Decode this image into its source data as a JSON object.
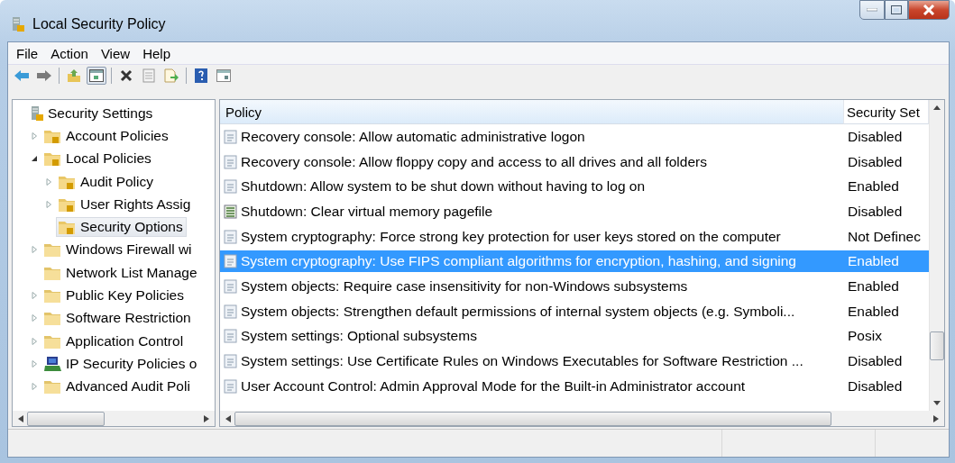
{
  "window": {
    "title": "Local Security Policy"
  },
  "menu": [
    "File",
    "Action",
    "View",
    "Help"
  ],
  "toolbar": [
    {
      "kind": "back",
      "pressed": false
    },
    {
      "kind": "forward",
      "pressed": false
    },
    {
      "kind": "sep"
    },
    {
      "kind": "up",
      "pressed": false
    },
    {
      "kind": "tree",
      "pressed": true
    },
    {
      "kind": "sep"
    },
    {
      "kind": "delete",
      "pressed": false
    },
    {
      "kind": "properties",
      "pressed": false
    },
    {
      "kind": "export",
      "pressed": false
    },
    {
      "kind": "sep"
    },
    {
      "kind": "help",
      "pressed": false
    },
    {
      "kind": "console",
      "pressed": false
    }
  ],
  "tree": [
    {
      "label": "Security Settings",
      "kind": "root",
      "selected": false,
      "children": [
        {
          "label": "Account Policies",
          "kind": "secure",
          "expanded": false,
          "selected": false
        },
        {
          "label": "Local Policies",
          "kind": "secure",
          "expanded": true,
          "selected": false,
          "children": [
            {
              "label": "Audit Policy",
              "kind": "secure",
              "expanded": false,
              "selected": false
            },
            {
              "label": "User Rights Assig",
              "kind": "secure",
              "expanded": false,
              "selected": false
            },
            {
              "label": "Security Options",
              "kind": "secure",
              "selected": true
            }
          ]
        },
        {
          "label": "Windows Firewall wi",
          "kind": "folder",
          "expanded": false,
          "selected": false
        },
        {
          "label": "Network List Manage",
          "kind": "folder",
          "selected": false
        },
        {
          "label": "Public Key Policies",
          "kind": "folder",
          "expanded": false,
          "selected": false
        },
        {
          "label": "Software Restriction",
          "kind": "folder",
          "expanded": false,
          "selected": false
        },
        {
          "label": "Application Control",
          "kind": "folder",
          "expanded": false,
          "selected": false
        },
        {
          "label": "IP Security Policies o",
          "kind": "network",
          "expanded": false,
          "selected": false
        },
        {
          "label": "Advanced Audit Poli",
          "kind": "folder",
          "expanded": false,
          "selected": false
        }
      ]
    }
  ],
  "table": {
    "columns": [
      "Policy",
      "Security Set"
    ],
    "rows": [
      {
        "policy": "Recovery console: Allow automatic administrative logon",
        "setting": "Disabled",
        "kind": "policy",
        "selected": false
      },
      {
        "policy": "Recovery console: Allow floppy copy and access to all drives and all folders",
        "setting": "Disabled",
        "kind": "policy",
        "selected": false
      },
      {
        "policy": "Shutdown: Allow system to be shut down without having to log on",
        "setting": "Enabled",
        "kind": "policy",
        "selected": false
      },
      {
        "policy": "Shutdown: Clear virtual memory pagefile",
        "setting": "Disabled",
        "kind": "pagefile",
        "selected": false
      },
      {
        "policy": "System cryptography: Force strong key protection for user keys stored on the computer",
        "setting": "Not Definec",
        "kind": "policy",
        "selected": false
      },
      {
        "policy": "System cryptography: Use FIPS compliant algorithms for encryption, hashing, and signing",
        "setting": "Enabled",
        "kind": "policy",
        "selected": true
      },
      {
        "policy": "System objects: Require case insensitivity for non-Windows subsystems",
        "setting": "Enabled",
        "kind": "policy",
        "selected": false
      },
      {
        "policy": "System objects: Strengthen default permissions of internal system objects (e.g. Symboli...",
        "setting": "Enabled",
        "kind": "policy",
        "selected": false
      },
      {
        "policy": "System settings: Optional subsystems",
        "setting": "Posix",
        "kind": "policy",
        "selected": false
      },
      {
        "policy": "System settings: Use Certificate Rules on Windows Executables for Software Restriction ...",
        "setting": "Disabled",
        "kind": "policy",
        "selected": false
      },
      {
        "policy": "User Account Control: Admin Approval Mode for the Built-in Administrator account",
        "setting": "Disabled",
        "kind": "policy",
        "selected": false
      }
    ]
  }
}
